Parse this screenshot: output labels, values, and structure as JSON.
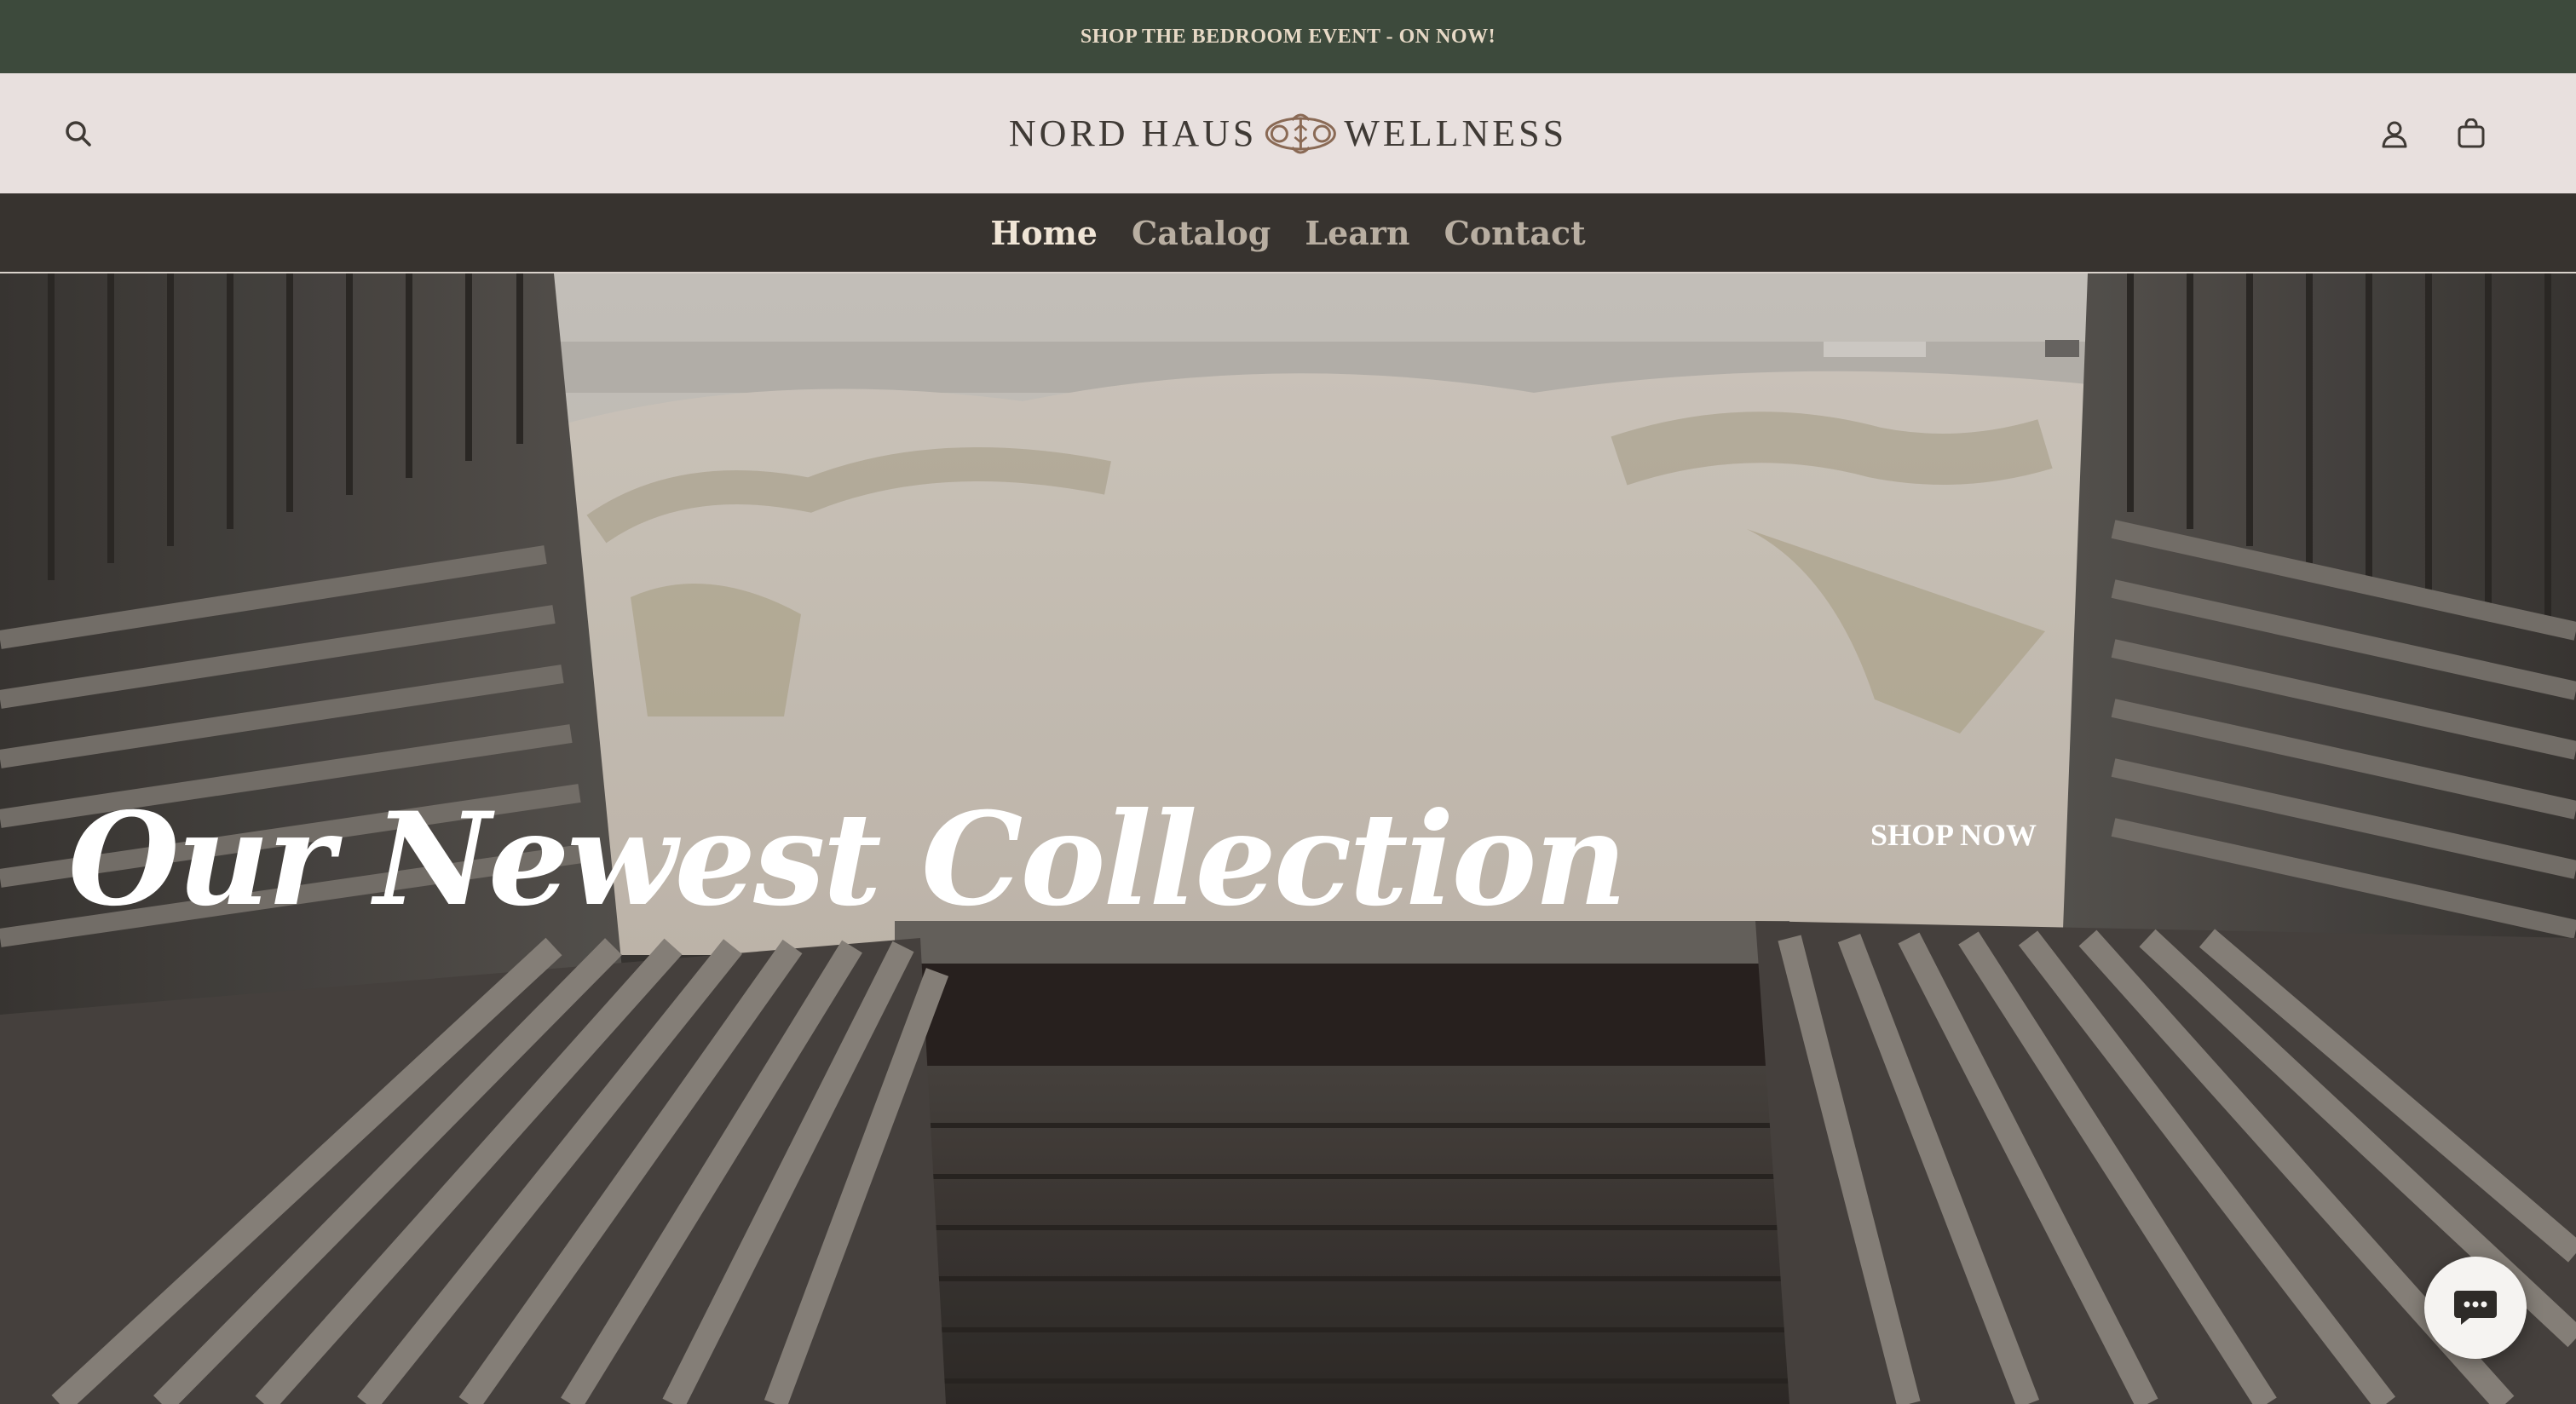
{
  "announcement": {
    "text": "SHOP THE BEDROOM EVENT - ON NOW!"
  },
  "header": {
    "logo_left": "NORD HAUS",
    "logo_right": "WELLNESS",
    "search_icon": "search-icon",
    "account_icon": "user-icon",
    "cart_icon": "bag-icon"
  },
  "nav": {
    "items": [
      {
        "label": "Home",
        "active": true
      },
      {
        "label": "Catalog",
        "active": false
      },
      {
        "label": "Learn",
        "active": false
      },
      {
        "label": "Contact",
        "active": false
      }
    ]
  },
  "hero": {
    "title": "Our Newest Collection",
    "cta": "SHOP NOW"
  },
  "chat": {
    "icon": "chat-bubble-icon"
  },
  "colors": {
    "announcement_bg": "#3d4a3c",
    "announcement_text": "#e7d9c6",
    "header_bg": "#e8e0de",
    "nav_bg": "#37332f",
    "nav_active": "#f0e5d6",
    "nav_inactive": "#b8aea1"
  }
}
